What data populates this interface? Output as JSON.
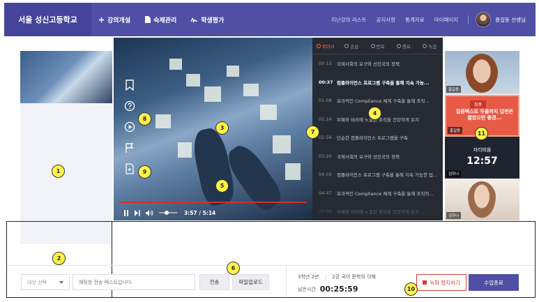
{
  "header": {
    "school_name": "서울 성신고등학교",
    "menu": [
      {
        "label": "강의개설",
        "icon": "plus-icon"
      },
      {
        "label": "숙제관리",
        "icon": "document-icon"
      },
      {
        "label": "학생평가",
        "icon": "signature-icon"
      }
    ],
    "links": [
      "지난강의 리스트",
      "공지사항",
      "통계자료",
      "마이페이지"
    ],
    "user_name": "홍길동 선생님"
  },
  "video": {
    "time": "3:57 / 5:14",
    "tools": [
      "bookmark-icon",
      "help-icon",
      "play-circle-icon",
      "flag-icon",
      "note-icon"
    ]
  },
  "bookmarks": {
    "tabs": [
      {
        "label": "북마크",
        "active": true
      },
      {
        "label": "궁금",
        "active": false
      },
      {
        "label": "반복",
        "active": false
      },
      {
        "label": "중요",
        "active": false
      },
      {
        "label": "녹음",
        "active": false
      }
    ],
    "items": [
      {
        "time": "00:15",
        "text": "국제사회의 요구와 선진국의 정책",
        "active": false
      },
      {
        "time": "00:37",
        "text": "컴플라이언스 프로그램 구축을 통해 지속 가능...",
        "active": true
      },
      {
        "time": "01:08",
        "text": "효과적인 Compliance 체계 구축을 통해 조직...",
        "active": false
      },
      {
        "time": "01:24",
        "text": "부패와 비리에 노출된 조직을 건강하게 유지",
        "active": false
      },
      {
        "time": "02:56",
        "text": "단순한 컴플라이언스 프로그램을 구축",
        "active": false
      },
      {
        "time": "03:20",
        "text": "국제사회의 요구와 선진국의 정책",
        "active": false
      },
      {
        "time": "04:03",
        "text": "컴플라이언스 프로그램 구축을 통해 지속 가능한 업...",
        "active": false
      },
      {
        "time": "04:47",
        "text": "효과적인 Compliance 체계 구축을 통해 조직의...",
        "active": false
      },
      {
        "time": "05:06",
        "text": "부패와 비리에 노출된 조직을 건강하게 유지",
        "active": false
      }
    ]
  },
  "students": [
    {
      "name": "홍길동"
    },
    {
      "name": "홍길동",
      "badge": "집중",
      "warning": "집중텍스트 두줄까지 답변은 짧았으면 좋겠...",
      "accent": "#e75a46"
    },
    {
      "name": "김하나",
      "status_label": "자리비움",
      "timer": "12:57"
    },
    {
      "name": "김하나"
    }
  ],
  "chat": {
    "select_placeholder": "대상 선택",
    "input_placeholder": "채팅창 전송 텍스트입니다.",
    "send_label": "전송",
    "upload_label": "파일업로드"
  },
  "class_info": {
    "grade_class": "3학년 2반",
    "lesson": "2강 국어 문학의 이해",
    "remaining_label": "남은시간",
    "remaining_time": "00:25:59"
  },
  "actions": {
    "stop_recording_label": "녹화 정지하기",
    "end_class_label": "수업종료"
  },
  "markers": [
    "1",
    "2",
    "3",
    "4",
    "5",
    "6",
    "7",
    "8",
    "9",
    "10",
    "11"
  ],
  "colors": {
    "brand": "#4f4fa6",
    "accent_red": "#e03a2e",
    "marker_yellow": "#fff34a",
    "panel_dark": "#252a33"
  }
}
